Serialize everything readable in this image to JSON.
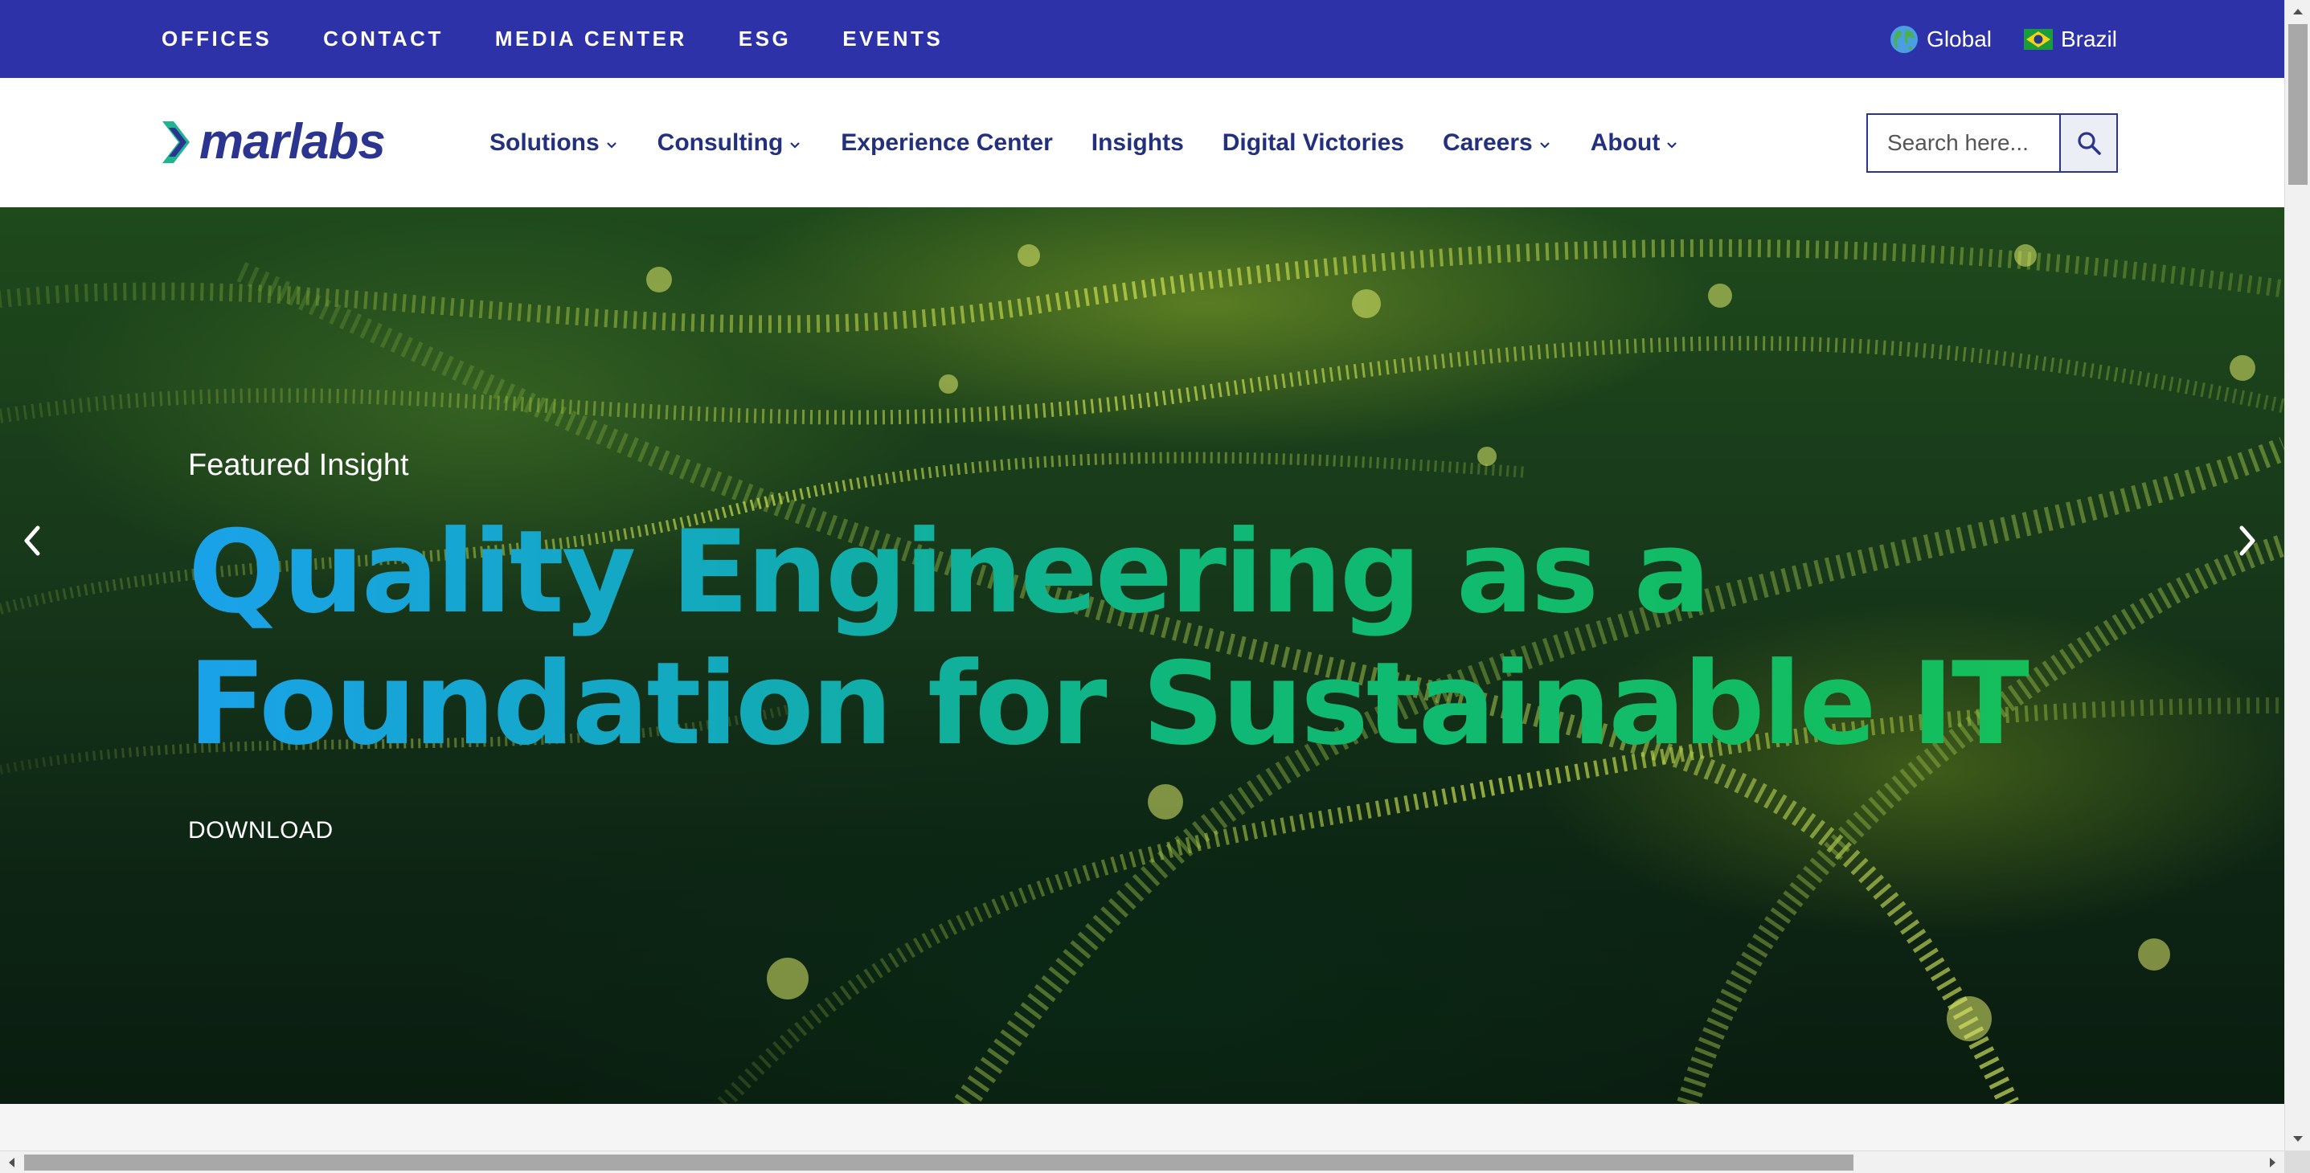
{
  "utility_nav": {
    "links": [
      "OFFICES",
      "CONTACT",
      "MEDIA CENTER",
      "ESG",
      "EVENTS"
    ],
    "regions": [
      {
        "label": "Global",
        "icon": "globe-icon"
      },
      {
        "label": "Brazil",
        "icon": "brazil-flag-icon"
      }
    ]
  },
  "header": {
    "logo_text": "marlabs",
    "nav": [
      {
        "label": "Solutions",
        "has_dropdown": true
      },
      {
        "label": "Consulting",
        "has_dropdown": true
      },
      {
        "label": "Experience Center",
        "has_dropdown": false
      },
      {
        "label": "Insights",
        "has_dropdown": false
      },
      {
        "label": "Digital Victories",
        "has_dropdown": false
      },
      {
        "label": "Careers",
        "has_dropdown": true
      },
      {
        "label": "About",
        "has_dropdown": true
      }
    ],
    "search": {
      "placeholder": "Search here...",
      "value": ""
    }
  },
  "hero": {
    "eyebrow": "Featured Insight",
    "headline_line1": "Quality Engineering as a",
    "headline_line2": "Foundation for Sustainable IT",
    "cta": "DOWNLOAD"
  },
  "colors": {
    "topbar_bg": "#2e32a8",
    "nav_text": "#22307e",
    "headline_gradient_start": "#1aa2ea",
    "headline_gradient_end": "#14bf5a"
  }
}
